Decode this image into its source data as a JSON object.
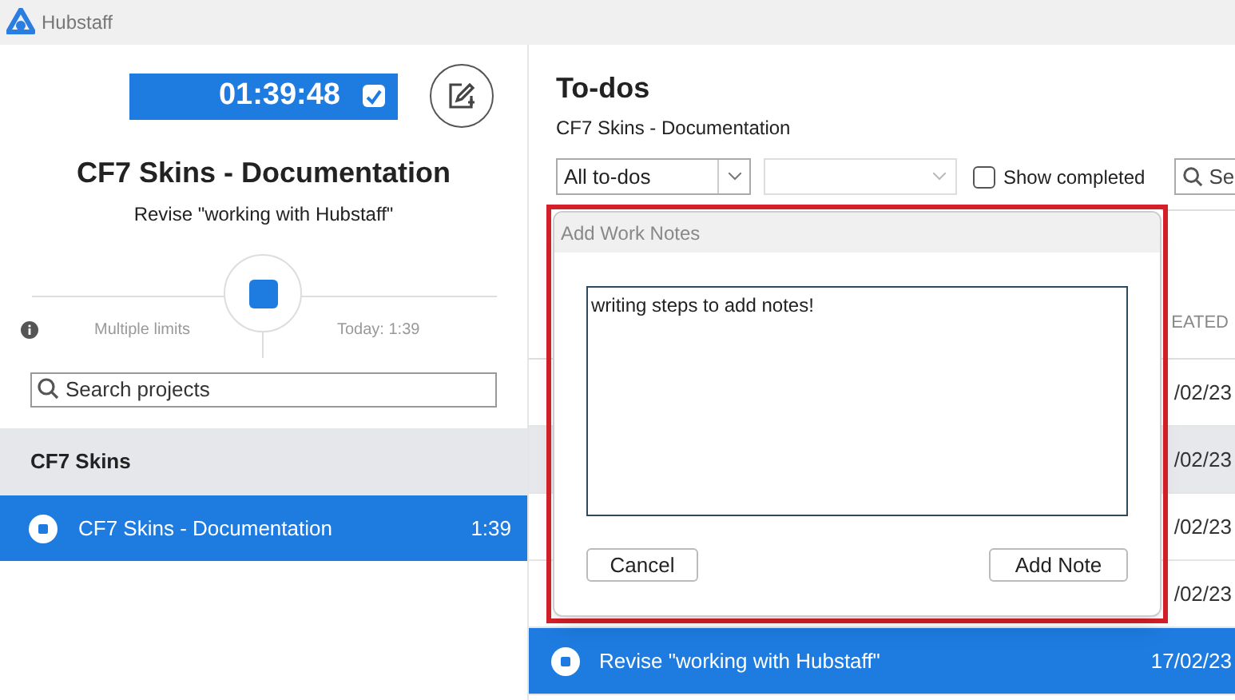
{
  "window": {
    "title": "Hubstaff"
  },
  "timer": {
    "time": "01:39:48",
    "checked": true
  },
  "current": {
    "project": "CF7 Skins - Documentation",
    "task": "Revise \"working with Hubstaff\""
  },
  "limits": {
    "label": "Multiple limits",
    "today": "Today: 1:39"
  },
  "project_search": {
    "placeholder": "Search projects"
  },
  "project_groups": [
    {
      "name": "CF7 Skins",
      "items": [
        {
          "name": "CF7 Skins - Documentation",
          "time": "1:39",
          "selected": true
        }
      ]
    }
  ],
  "todos": {
    "title": "To-dos",
    "subtitle": "CF7 Skins - Documentation",
    "filter": "All to-dos",
    "show_completed": false,
    "show_completed_label": "Show completed",
    "search_placeholder": "Se",
    "column": "EATED",
    "rows": [
      {
        "created": "/02/23",
        "hovered": false,
        "selected": false
      },
      {
        "created": "/02/23",
        "hovered": true,
        "selected": false
      },
      {
        "created": "/02/23",
        "hovered": false,
        "selected": false
      },
      {
        "created": "/02/23",
        "hovered": false,
        "selected": false
      },
      {
        "task": "Revise \"working with Hubstaff\"",
        "created": "17/02/23",
        "selected": true
      }
    ]
  },
  "dialog": {
    "title": "Add Work Notes",
    "value": "writing steps to add notes!",
    "buttons": [
      "Cancel",
      "Add Note"
    ],
    "highlighted": true
  }
}
